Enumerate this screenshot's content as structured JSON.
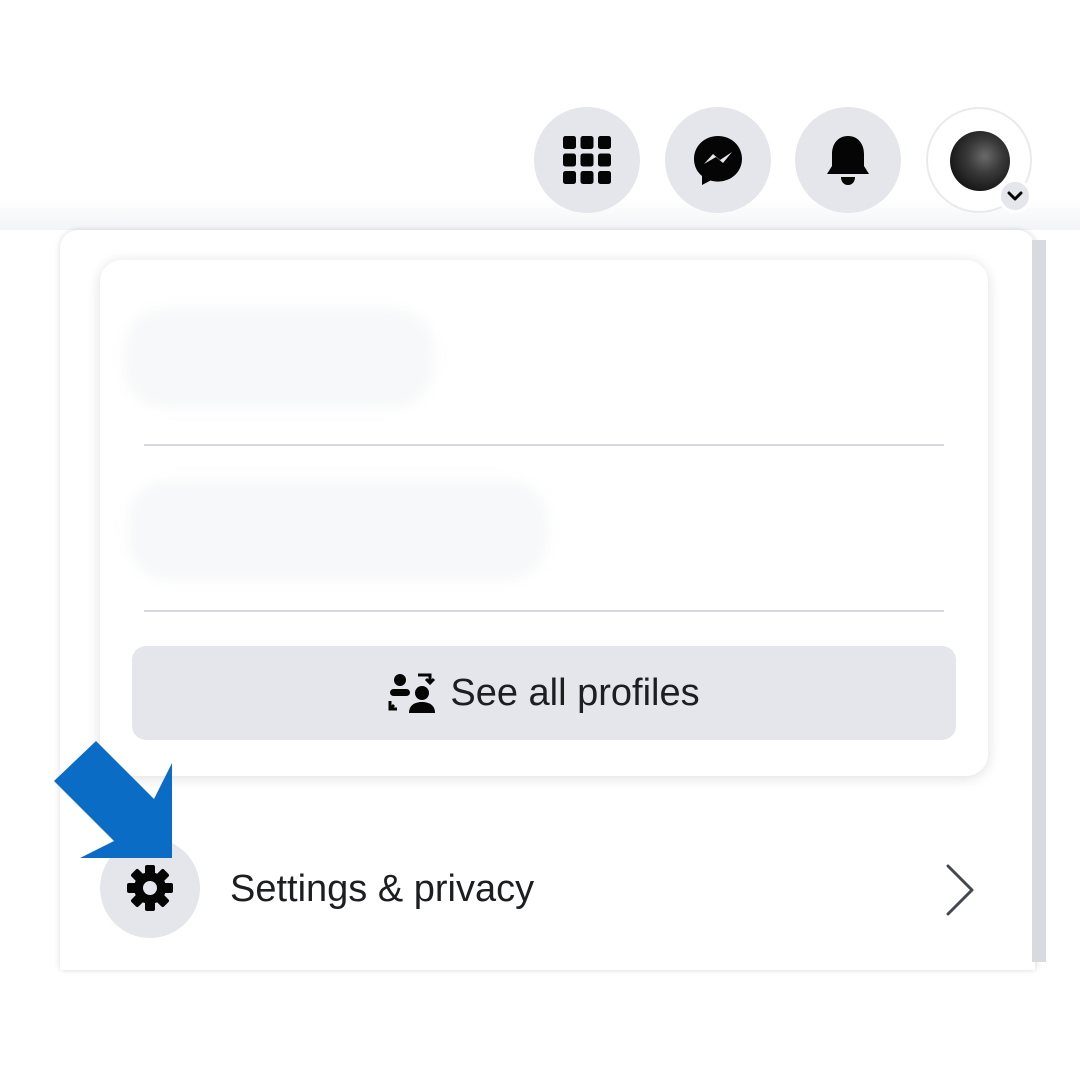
{
  "header": {
    "icons": {
      "menu": "menu-grid-icon",
      "messenger": "messenger-icon",
      "notifications": "bell-icon",
      "account": "account-avatar",
      "account_caret": "chevron-down-icon"
    }
  },
  "dropdown": {
    "profiles_card": {
      "see_all_label": "See all profiles",
      "see_all_icon": "switch-profiles-icon"
    },
    "settings_item": {
      "label": "Settings & privacy",
      "icon": "gear-icon",
      "chevron": "chevron-right-icon"
    }
  },
  "annotation": {
    "arrow_color": "#0a6cc4",
    "arrow_icon": "arrow-down-right-icon"
  },
  "colors": {
    "icon_button_bg": "#e4e6eb",
    "text": "#1c1e21"
  }
}
